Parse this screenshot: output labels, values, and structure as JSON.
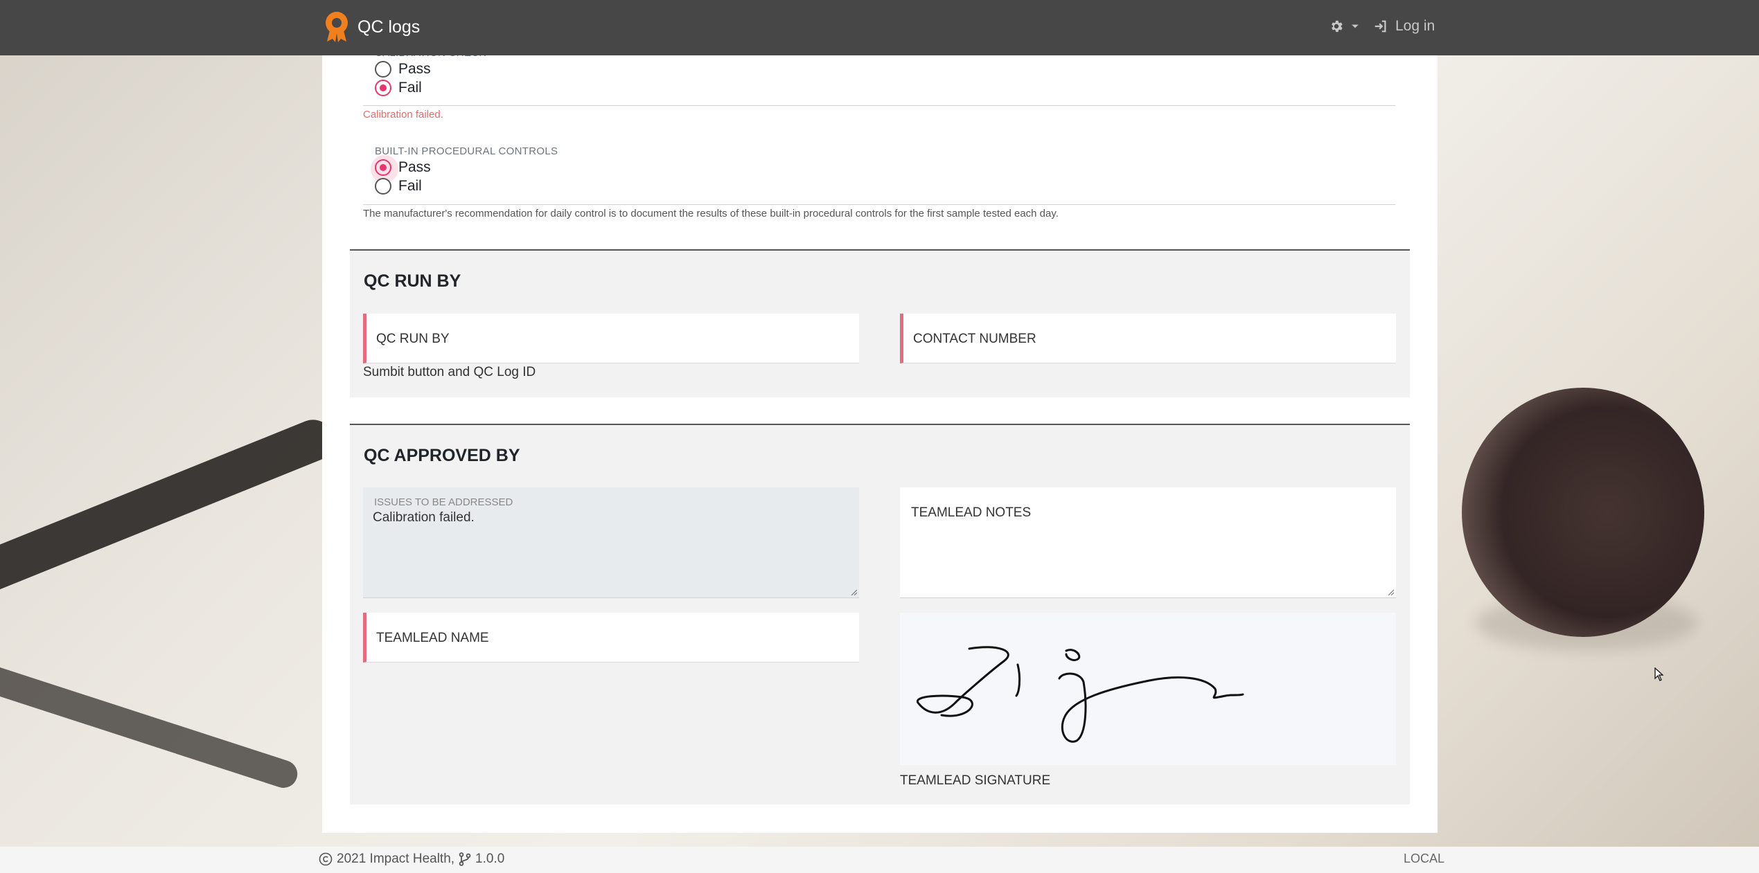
{
  "navbar": {
    "brand": "QC logs",
    "settings_icon": "gear-icon",
    "login_icon": "sign-in-icon",
    "login_label": "Log in"
  },
  "calibration": {
    "label": "CALIBRATION CHECK",
    "options": [
      "Pass",
      "Fail"
    ],
    "selected": "Fail",
    "error": "Calibration failed."
  },
  "procedural": {
    "label": "BUILT-IN PROCEDURAL CONTROLS",
    "options": [
      "Pass",
      "Fail"
    ],
    "selected": "Pass",
    "hint": "The manufacturer's recommendation for daily control is to document the results of these built-in procedural controls for the first sample tested each day."
  },
  "qc_run_by": {
    "title": "QC RUN BY",
    "run_by_label": "QC RUN BY",
    "contact_label": "CONTACT NUMBER",
    "note": "Sumbit button and QC Log ID"
  },
  "qc_approved_by": {
    "title": "QC APPROVED BY",
    "issues_label": "ISSUES TO BE ADDRESSED",
    "issues_value": "Calibration failed.",
    "notes_label": "TEAMLEAD NOTES",
    "name_label": "TEAMLEAD NAME",
    "signature_caption": "TEAMLEAD SIGNATURE"
  },
  "footer": {
    "copyright": "2021 Impact Health,",
    "version": "1.0.0",
    "env": "LOCAL"
  },
  "colors": {
    "accent": "#e8356d",
    "navbar": "#474747",
    "brand_icon": "#f07f1e",
    "required_bar": "#e56b7f"
  }
}
